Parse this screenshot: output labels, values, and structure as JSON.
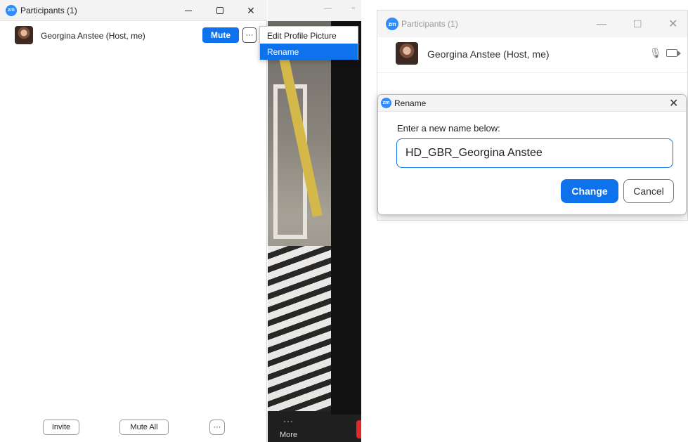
{
  "left_window": {
    "title": "Participants (1)",
    "controls": {
      "minimize": "–",
      "maximize": "",
      "close": "✕"
    },
    "participant": {
      "name": "Georgina Anstee (Host, me)",
      "mute_label": "Mute",
      "more_label": "···"
    },
    "footer": {
      "invite_label": "Invite",
      "mute_all_label": "Mute All",
      "more_label": "···"
    }
  },
  "context_menu": {
    "items": [
      {
        "label": "Edit Profile Picture"
      },
      {
        "label": "Rename",
        "highlighted": true
      }
    ]
  },
  "video_panel": {
    "dots": "···",
    "more_label": "More"
  },
  "right_window": {
    "title": "Participants (1)",
    "controls": {
      "minimize": "—",
      "maximize": "☐",
      "close": "✕"
    },
    "participant": {
      "name": "Georgina Anstee (Host, me)"
    },
    "icons": {
      "mic": "microphone-icon",
      "camera": "video-camera-icon"
    }
  },
  "rename_dialog": {
    "title": "Rename",
    "close": "✕",
    "prompt": "Enter a new name below:",
    "input_value": "HD_GBR_Georgina Anstee",
    "change_label": "Change",
    "cancel_label": "Cancel"
  },
  "colors": {
    "zoom_blue": "#0e72ed",
    "logo_blue": "#2d8cff"
  },
  "logo_text": "zm"
}
